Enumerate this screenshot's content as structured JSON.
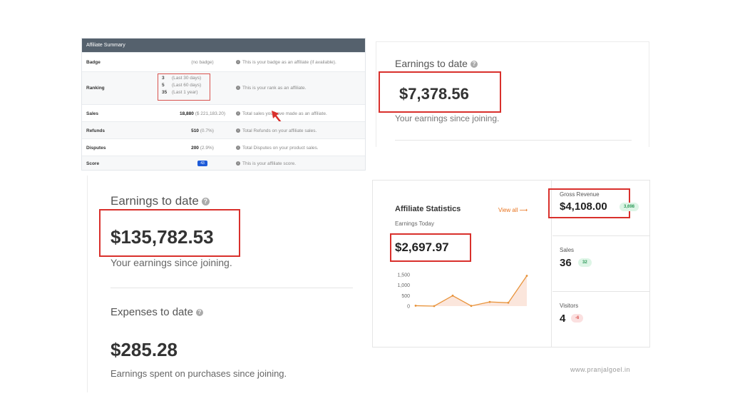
{
  "summary": {
    "header": "Affiliate Summary",
    "rows": [
      {
        "label": "Badge",
        "value": "(no badge)",
        "info": "This is your badge as an affiliate (if available)."
      },
      {
        "label": "Ranking",
        "ranks": [
          {
            "n": "3",
            "period": "(Last 30 days)"
          },
          {
            "n": "5",
            "period": "(Last 60 days)"
          },
          {
            "n": "35",
            "period": "(Last 1 year)"
          }
        ],
        "info": "This is your rank as an affiliate."
      },
      {
        "label": "Sales",
        "value": "18,880",
        "extra": "($ 221,183.20)",
        "info": "Total sales you have made as an affiliate."
      },
      {
        "label": "Refunds",
        "value": "510",
        "extra": "(0.7%)",
        "info": "Total Refunds on your affiliate sales."
      },
      {
        "label": "Disputes",
        "value": "200",
        "extra": "(2.9%)",
        "info": "Total Disputes on your product sales."
      },
      {
        "label": "Score",
        "badge": "43",
        "info": "This is your affiliate score."
      }
    ]
  },
  "card_top": {
    "title": "Earnings to date",
    "amount": "$7,378.56",
    "subtitle": "Your earnings since joining."
  },
  "card_bottom": {
    "title": "Earnings to date",
    "amount": "$135,782.53",
    "subtitle": "Your earnings since joining.",
    "expenses_title": "Expenses to date",
    "expenses_amount": "$285.28",
    "expenses_subtitle": "Earnings spent on purchases since joining."
  },
  "stats": {
    "title": "Affiliate Statistics",
    "view_all": "View all ⟶",
    "earnings_label": "Earnings Today",
    "earnings_amount": "$2,697.97",
    "gross_label": "Gross Revenue",
    "gross_value": "$4,108.00",
    "gross_badge": "3,698",
    "sales_label": "Sales",
    "sales_value": "36",
    "sales_badge": "32",
    "visitors_label": "Visitors",
    "visitors_value": "4",
    "visitors_badge": "-6"
  },
  "chart_data": {
    "type": "area",
    "y_ticks": [
      "1,500",
      "1,000",
      "500",
      "0"
    ],
    "ylim": [
      0,
      1500
    ],
    "values": [
      20,
      0,
      500,
      10,
      200,
      160,
      1450
    ],
    "color": "#e8933a"
  },
  "watermark": "www.pranjalgoel.in",
  "colors": {
    "highlight_box": "#d9302c",
    "accent": "#e8731e",
    "header": "#55616d"
  }
}
